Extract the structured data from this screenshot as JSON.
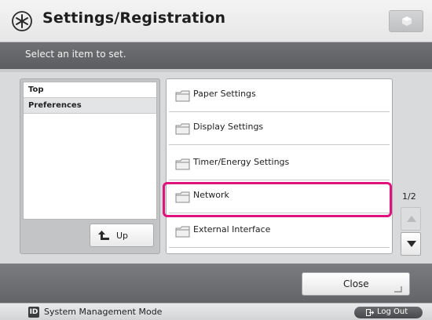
{
  "header": {
    "title": "Settings/Registration",
    "icon": "settings-asterisk-icon",
    "top_right_icon": "cube-icon"
  },
  "instruction": "Select an item to set.",
  "tree": {
    "items": [
      {
        "label": "Top",
        "selected": false
      },
      {
        "label": "Preferences",
        "selected": true
      }
    ],
    "up_label": "Up",
    "up_icon": "up-arrow-icon"
  },
  "list": {
    "items": [
      {
        "label": "Paper Settings",
        "icon": "folder-icon"
      },
      {
        "label": "Display Settings",
        "icon": "folder-icon"
      },
      {
        "label": "Timer/Energy Settings",
        "icon": "folder-icon"
      },
      {
        "label": "Network",
        "icon": "folder-icon",
        "highlighted": true
      },
      {
        "label": "External Interface",
        "icon": "folder-icon"
      }
    ],
    "highlight_color": "#e0127e"
  },
  "pagination": {
    "label": "1/2"
  },
  "footer": {
    "close_label": "Close"
  },
  "status": {
    "mode_badge": "ID",
    "mode_text": "System Management Mode",
    "logout_label": "Log Out",
    "logout_icon": "logout-icon"
  }
}
